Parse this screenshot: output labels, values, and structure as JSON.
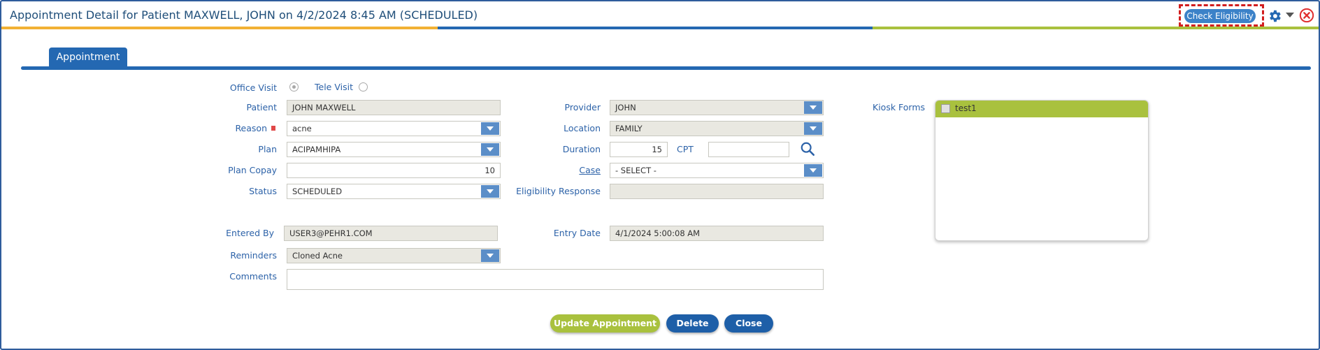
{
  "window": {
    "title": "Appointment Detail for Patient MAXWELL, JOHN on 4/2/2024 8:45 AM (SCHEDULED)",
    "check_eligibility_label": "Check Eligibility",
    "settings_icon": "gear-icon",
    "close_icon": "close-circle-icon",
    "stripe_colors": [
      "#f2b134",
      "#2468b2",
      "#a9c13e"
    ]
  },
  "tabs": [
    {
      "label": "Appointment",
      "active": true
    }
  ],
  "form": {
    "visit_type": {
      "office_label": "Office Visit",
      "tele_label": "Tele Visit",
      "selected": "Office Visit"
    },
    "patient": {
      "label": "Patient",
      "value": "JOHN MAXWELL"
    },
    "reason": {
      "label": "Reason",
      "value": "acne"
    },
    "plan": {
      "label": "Plan",
      "value": "ACIPAMHIPA"
    },
    "plan_copay": {
      "label": "Plan Copay",
      "value": "10"
    },
    "status": {
      "label": "Status",
      "value": "SCHEDULED"
    },
    "entered_by": {
      "label": "Entered By",
      "value": "USER3@PEHR1.COM"
    },
    "reminders": {
      "label": "Reminders",
      "value": "Cloned Acne"
    },
    "comments": {
      "label": "Comments",
      "value": ""
    },
    "provider": {
      "label": "Provider",
      "value": "JOHN"
    },
    "location": {
      "label": "Location",
      "value": "FAMILY"
    },
    "duration": {
      "label": "Duration",
      "value": "15"
    },
    "cpt": {
      "label": "CPT",
      "value": ""
    },
    "case": {
      "label": "Case",
      "value": "- SELECT -"
    },
    "eligibility_response": {
      "label": "Eligibility Response",
      "value": ""
    },
    "entry_date": {
      "label": "Entry Date",
      "value": "4/1/2024 5:00:08 AM"
    },
    "search_icon": "search-icon"
  },
  "kiosk": {
    "label": "Kiosk Forms",
    "items": [
      {
        "label": "test1",
        "checked": false
      }
    ]
  },
  "actions": {
    "update_label": "Update Appointment",
    "delete_label": "Delete",
    "close_label": "Close"
  }
}
